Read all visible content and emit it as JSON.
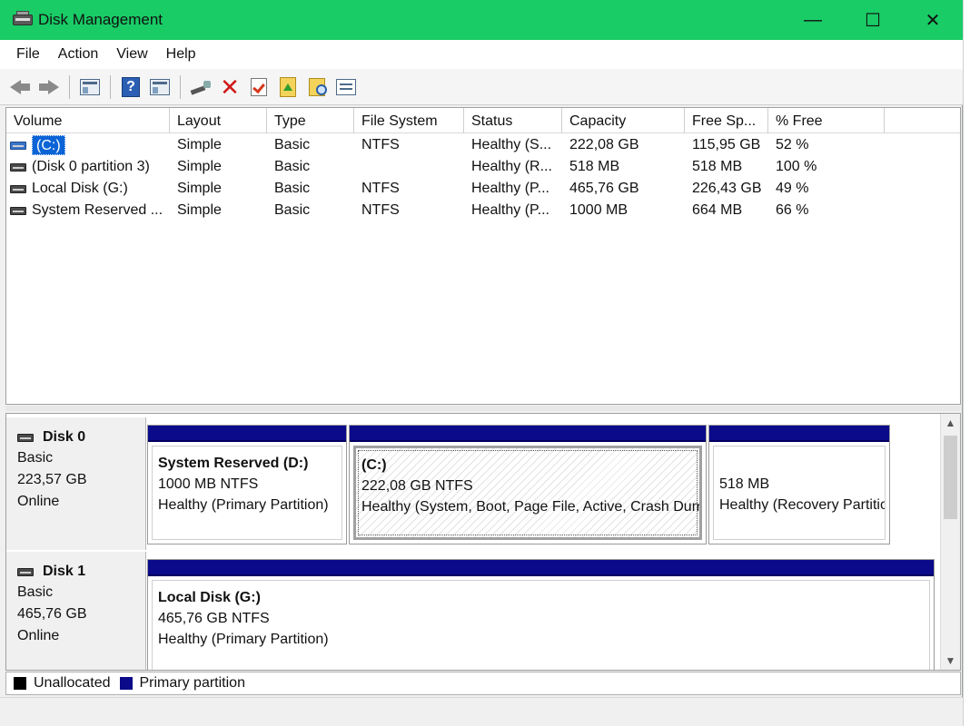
{
  "window": {
    "title": "Disk Management",
    "minimize_glyph": "—",
    "maximize_glyph": "☐",
    "close_glyph": "✕",
    "accent_color": "#19cc66"
  },
  "menu": {
    "file": "File",
    "action": "Action",
    "view": "View",
    "help": "Help"
  },
  "toolbar": {
    "icons": [
      "back-arrow-icon",
      "forward-arrow-icon",
      "console-tree-icon",
      "help-icon",
      "show-hide-pane-icon",
      "connect-disk-icon",
      "delete-icon",
      "check-properties-icon",
      "folder-up-icon",
      "folder-search-icon",
      "properties-icon"
    ]
  },
  "volume_list": {
    "columns": {
      "volume": "Volume",
      "layout": "Layout",
      "type": "Type",
      "file_system": "File System",
      "status": "Status",
      "capacity": "Capacity",
      "free_space": "Free Sp...",
      "percent_free": "% Free"
    },
    "rows": [
      {
        "volume": "(C:)",
        "layout": "Simple",
        "type": "Basic",
        "file_system": "NTFS",
        "status": "Healthy (S...",
        "capacity": "222,08 GB",
        "free_space": "115,95 GB",
        "percent_free": "52 %"
      },
      {
        "volume": "(Disk 0 partition 3)",
        "layout": "Simple",
        "type": "Basic",
        "file_system": "",
        "status": "Healthy (R...",
        "capacity": "518 MB",
        "free_space": "518 MB",
        "percent_free": "100 %"
      },
      {
        "volume": "Local Disk (G:)",
        "layout": "Simple",
        "type": "Basic",
        "file_system": "NTFS",
        "status": "Healthy (P...",
        "capacity": "465,76 GB",
        "free_space": "226,43 GB",
        "percent_free": "49 %"
      },
      {
        "volume": "System Reserved ...",
        "layout": "Simple",
        "type": "Basic",
        "file_system": "NTFS",
        "status": "Healthy (P...",
        "capacity": "1000 MB",
        "free_space": "664 MB",
        "percent_free": "66 %"
      }
    ]
  },
  "disks": [
    {
      "name": "Disk 0",
      "kind": "Basic",
      "size": "223,57 GB",
      "state": "Online",
      "partitions": [
        {
          "title": "System Reserved  (D:)",
          "size_fs": "1000 MB NTFS",
          "status": "Healthy (Primary Partition)"
        },
        {
          "title": "(C:)",
          "size_fs": "222,08 GB NTFS",
          "status": "Healthy (System, Boot, Page File, Active, Crash Dump, Primary Partition)"
        },
        {
          "title": "",
          "size_fs": "518 MB",
          "status": "Healthy (Recovery Partition)"
        }
      ]
    },
    {
      "name": "Disk 1",
      "kind": "Basic",
      "size": "465,76 GB",
      "state": "Online",
      "partitions": [
        {
          "title": "Local Disk  (G:)",
          "size_fs": "465,76 GB NTFS",
          "status": "Healthy (Primary Partition)"
        }
      ]
    }
  ],
  "legend": {
    "unallocated": "Unallocated",
    "unallocated_color": "#000000",
    "primary": "Primary partition",
    "primary_color": "#0a0a8a"
  }
}
